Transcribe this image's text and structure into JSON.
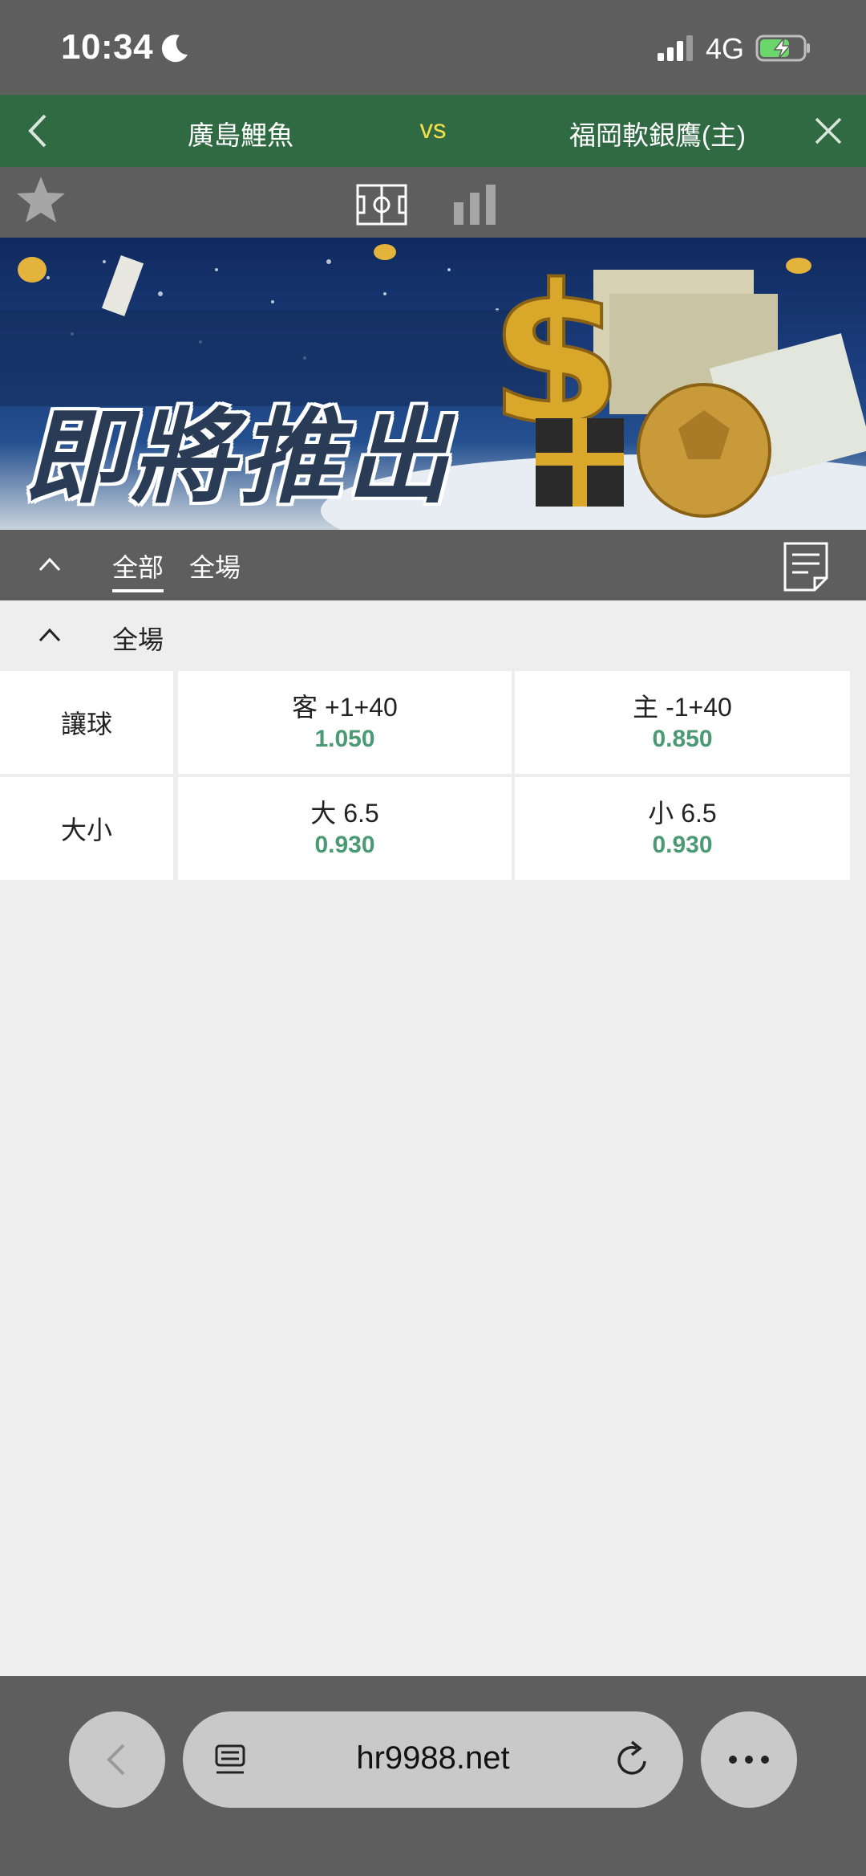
{
  "status_bar": {
    "time": "10:34",
    "network": "4G",
    "icons": [
      "moon-icon",
      "cellular-signal-icon",
      "battery-charging-icon"
    ]
  },
  "match": {
    "home_team": "廣島鯉魚",
    "vs": "vs",
    "away_team": "福岡軟銀鷹(主)"
  },
  "toolbar": {
    "icons": [
      "favorite-star-icon",
      "field-view-icon",
      "statistics-bar-icon"
    ]
  },
  "banner": {
    "title": "即將推出"
  },
  "filters": {
    "tabs": [
      {
        "label": "全部",
        "active": true
      },
      {
        "label": "全場",
        "active": false
      }
    ]
  },
  "section": {
    "title": "全場"
  },
  "markets": [
    {
      "label": "讓球",
      "options": [
        {
          "line": "客 +1+40",
          "odds": "1.050"
        },
        {
          "line": "主 -1+40",
          "odds": "0.850"
        }
      ]
    },
    {
      "label": "大小",
      "options": [
        {
          "line": "大 6.5",
          "odds": "0.930"
        },
        {
          "line": "小 6.5",
          "odds": "0.930"
        }
      ]
    }
  ],
  "browser": {
    "url": "hr9988.net"
  },
  "colors": {
    "header_green": "#2f6a43",
    "odds_green": "#4b9a74",
    "vs_yellow": "#f4e04a",
    "chrome_gray": "#5e5e5e",
    "content_bg": "#eeeeee"
  }
}
